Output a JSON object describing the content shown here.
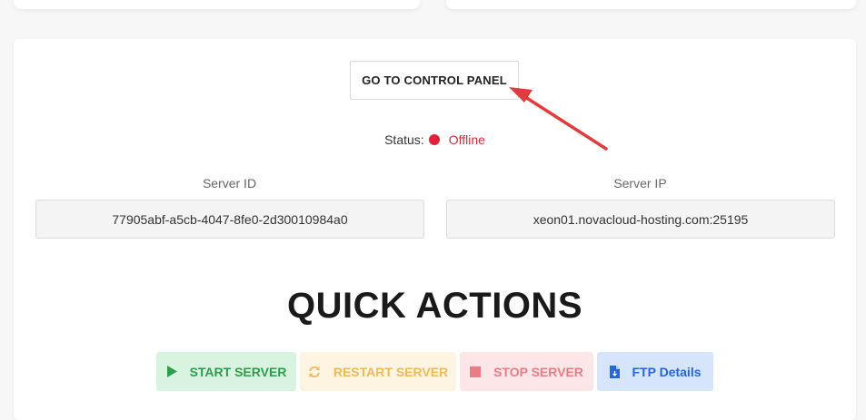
{
  "control_panel": {
    "label": "GO TO CONTROL PANEL"
  },
  "status": {
    "label": "Status:",
    "value": "Offline",
    "color": "#e0233b"
  },
  "server_id": {
    "label": "Server ID",
    "value": "77905abf-a5cb-4047-8fe0-2d30010984a0"
  },
  "server_ip": {
    "label": "Server IP",
    "value": "xeon01.novacloud-hosting.com:25195"
  },
  "quick_actions": {
    "title": "QUICK ACTIONS",
    "buttons": [
      {
        "label": "START SERVER",
        "icon": "play-icon",
        "color": "#2e9e4a",
        "bg": "#d8f3df"
      },
      {
        "label": "RESTART SERVER",
        "icon": "refresh-icon",
        "color": "#f0b955",
        "bg": "#fdf5e2"
      },
      {
        "label": "STOP SERVER",
        "icon": "stop-icon",
        "color": "#ea7c85",
        "bg": "#fde6e8"
      },
      {
        "label": "FTP Details",
        "icon": "file-icon",
        "color": "#2566d8",
        "bg": "#d6e5fb"
      }
    ]
  },
  "annotation_arrow_color": "#e23b3b"
}
